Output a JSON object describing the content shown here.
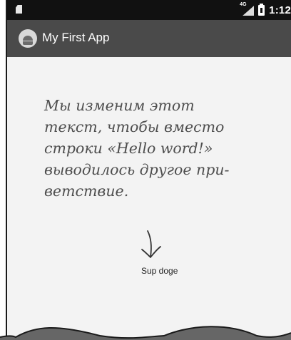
{
  "status_bar": {
    "network_label": "4G",
    "time": "1:12"
  },
  "app_bar": {
    "title": "My First App"
  },
  "content": {
    "text_view": "Sup doge"
  },
  "annotation": {
    "note": "Мы изменим этот\nтекст, чтобы вместо\nстроки «Hello word!»\nвыводилось другое при-\nветствие."
  }
}
